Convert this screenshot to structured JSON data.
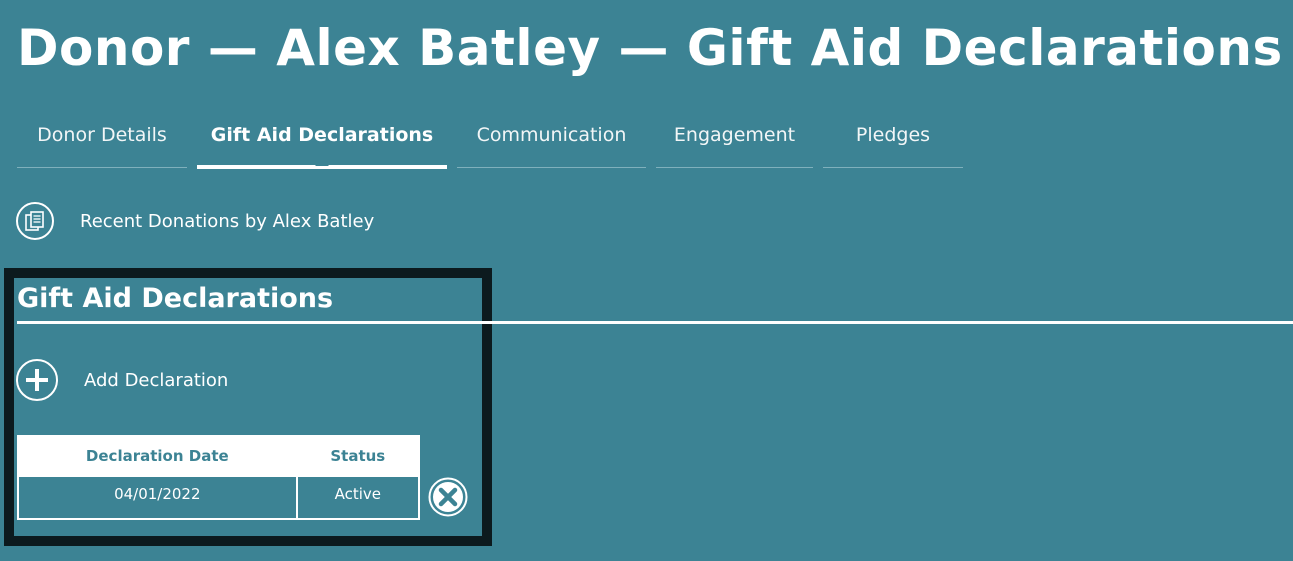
{
  "page": {
    "title": "Donor — Alex Batley — Gift Aid Declarations"
  },
  "tabs": [
    {
      "label": "Donor Details",
      "active": false
    },
    {
      "label": "Gift Aid Declarations",
      "active": true
    },
    {
      "label": "Communication",
      "active": false
    },
    {
      "label": "Engagement",
      "active": false
    },
    {
      "label": "Pledges",
      "active": false
    }
  ],
  "recent_donations": {
    "label": "Recent Donations by Alex Batley",
    "icon": "documents-icon"
  },
  "section": {
    "title": "Gift Aid Declarations",
    "add_label": "Add Declaration",
    "add_icon": "plus-circle-icon"
  },
  "table": {
    "columns": [
      "Declaration Date",
      "Status"
    ],
    "rows": [
      {
        "date": "04/01/2022",
        "status": "Active"
      }
    ],
    "delete_icon": "close-circle-icon"
  },
  "colors": {
    "background": "#3c8394",
    "text": "#ffffff",
    "highlight_border": "#0c1a1e"
  }
}
